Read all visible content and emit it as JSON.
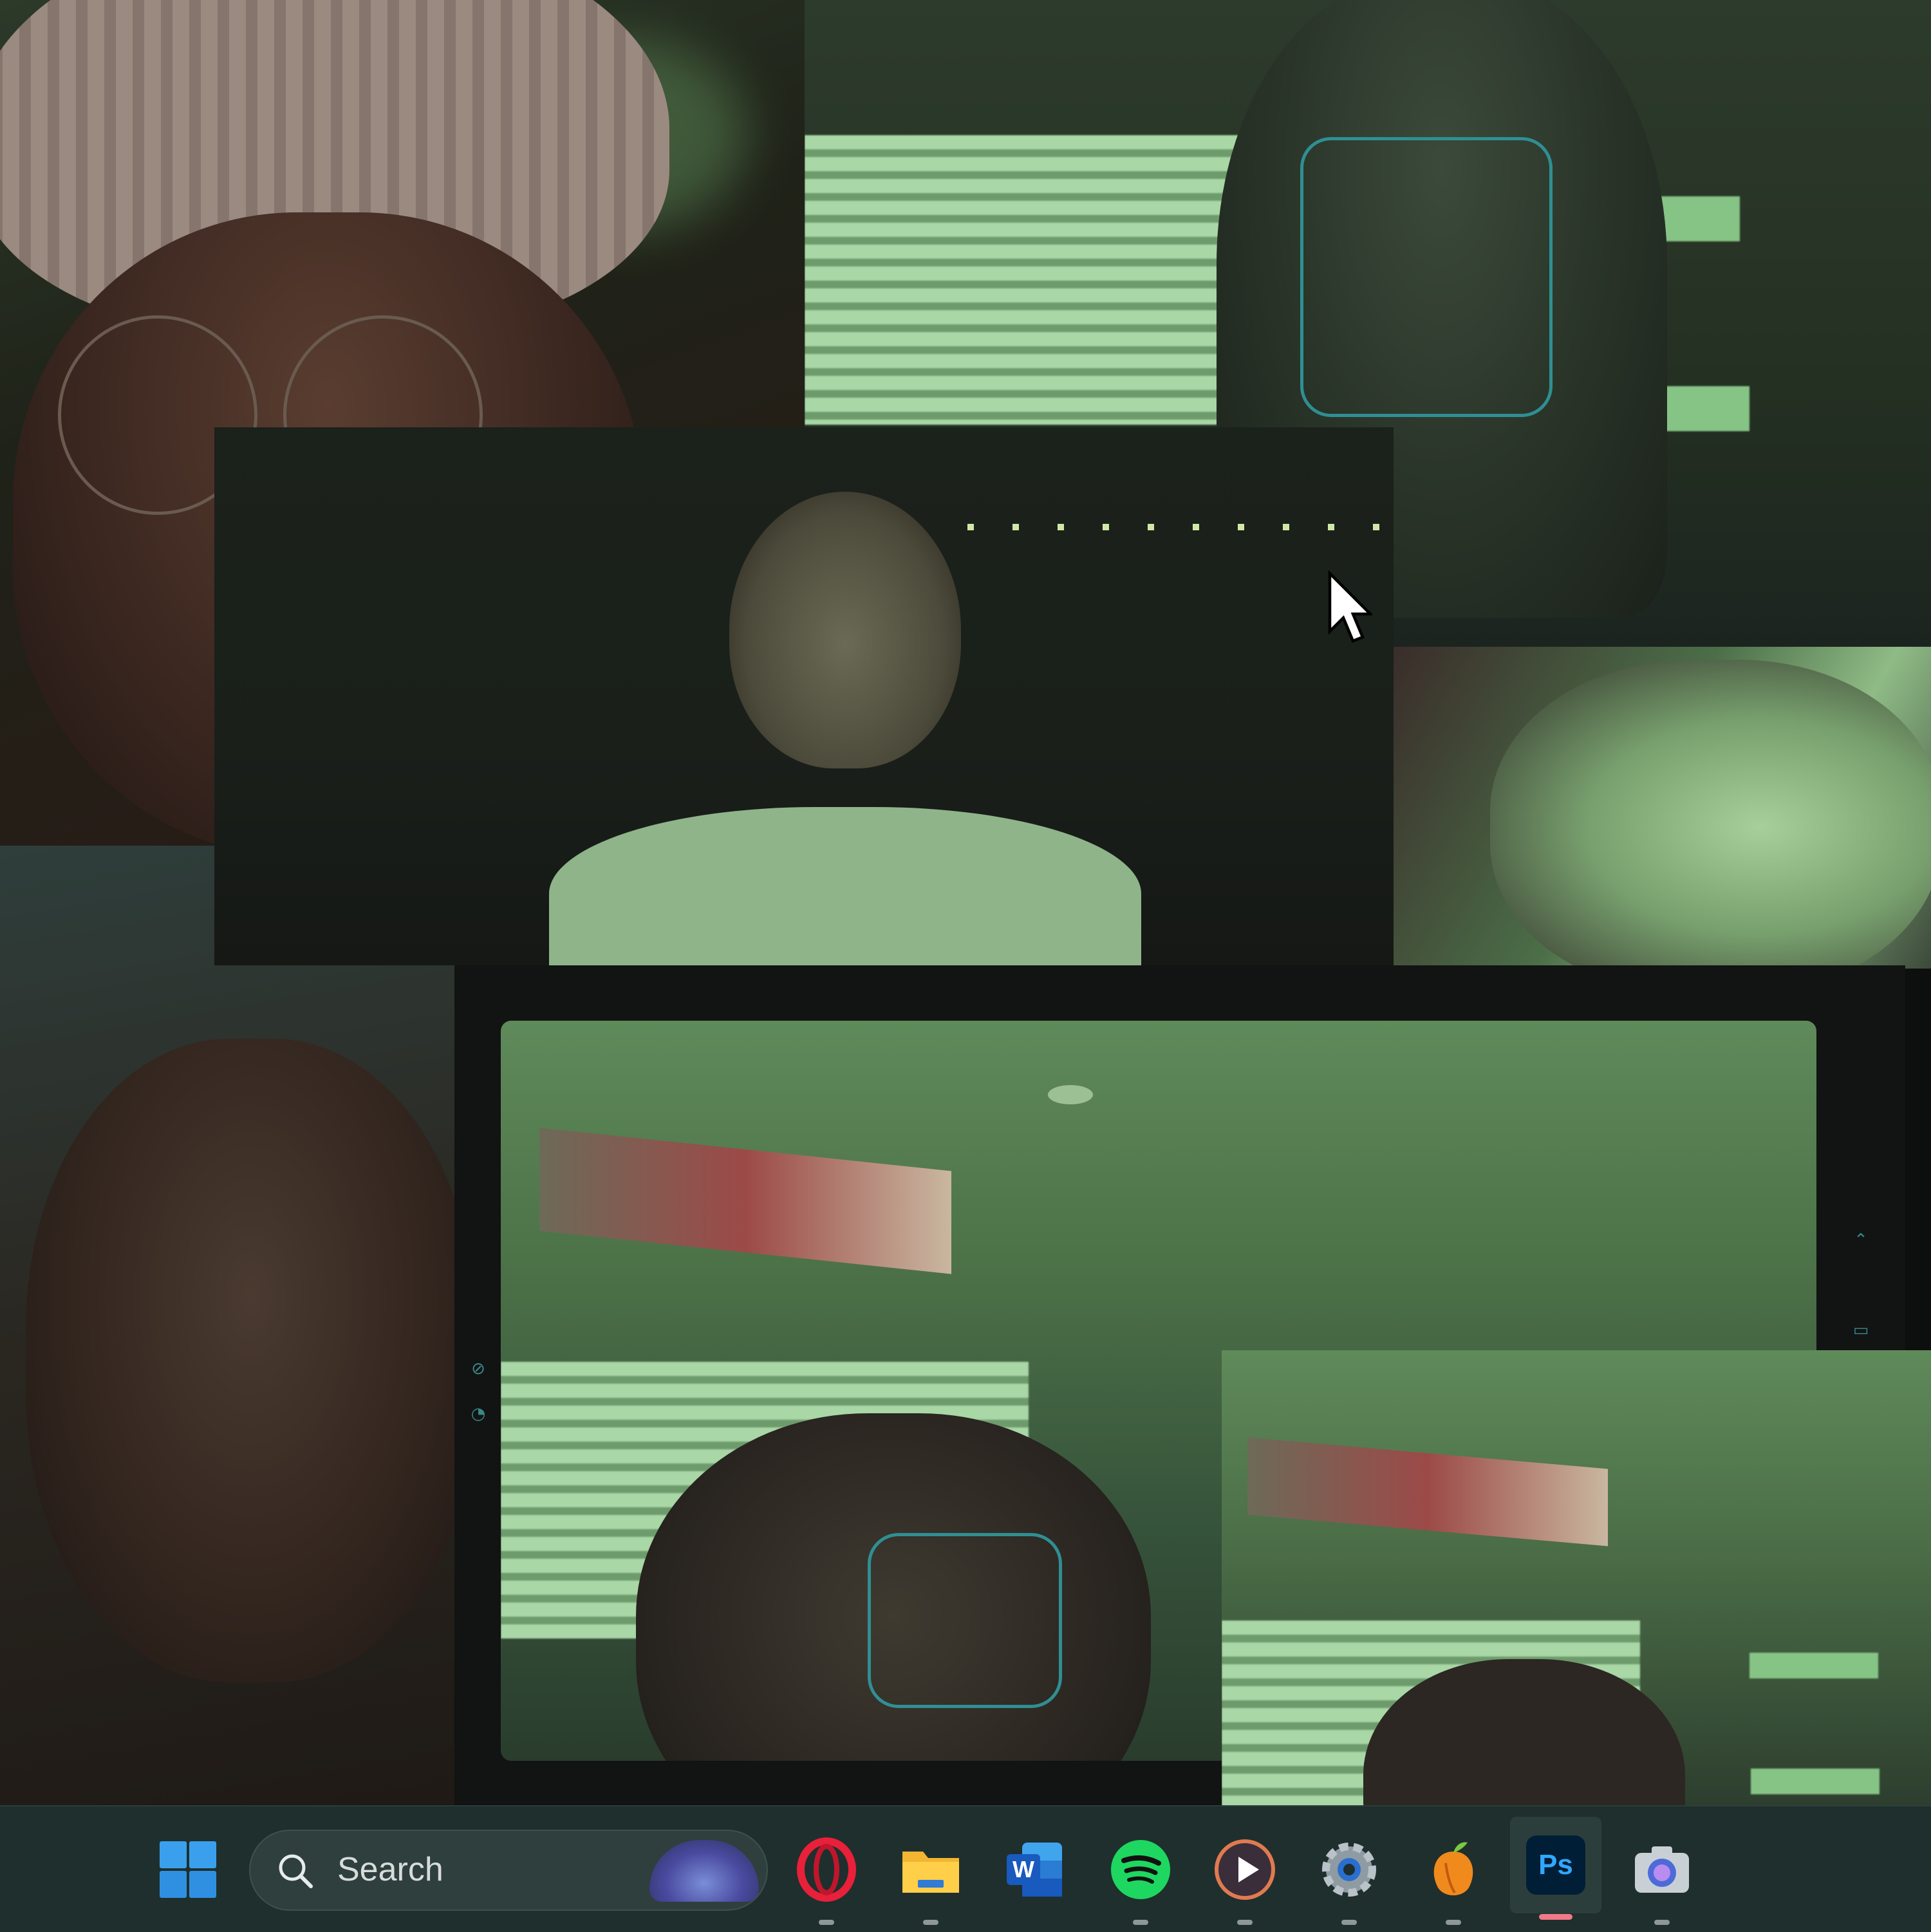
{
  "taskbar": {
    "search_placeholder": "Search",
    "apps": [
      {
        "name": "start",
        "icon": "windows-start-icon"
      },
      {
        "name": "opera",
        "icon": "opera-icon"
      },
      {
        "name": "file-explorer",
        "icon": "folder-icon"
      },
      {
        "name": "word",
        "icon": "word-icon",
        "glyph": "W"
      },
      {
        "name": "spotify",
        "icon": "spotify-icon"
      },
      {
        "name": "media-player",
        "icon": "play-icon"
      },
      {
        "name": "settings",
        "icon": "gear-icon"
      },
      {
        "name": "fl-studio",
        "icon": "fruit-icon"
      },
      {
        "name": "photoshop",
        "icon": "photoshop-icon",
        "glyph": "Ps",
        "active": true
      },
      {
        "name": "camera",
        "icon": "camera-icon"
      }
    ]
  },
  "camera_window": {
    "side_icons": [
      "hdr-off-icon",
      "timer-off-icon",
      "chevron-up-icon",
      "video-icon",
      "settings-small-icon"
    ]
  },
  "colors": {
    "accent_active": "#f07a87",
    "face_frame": "#2f8f93",
    "taskbar_bg": "#1f2f2d"
  }
}
